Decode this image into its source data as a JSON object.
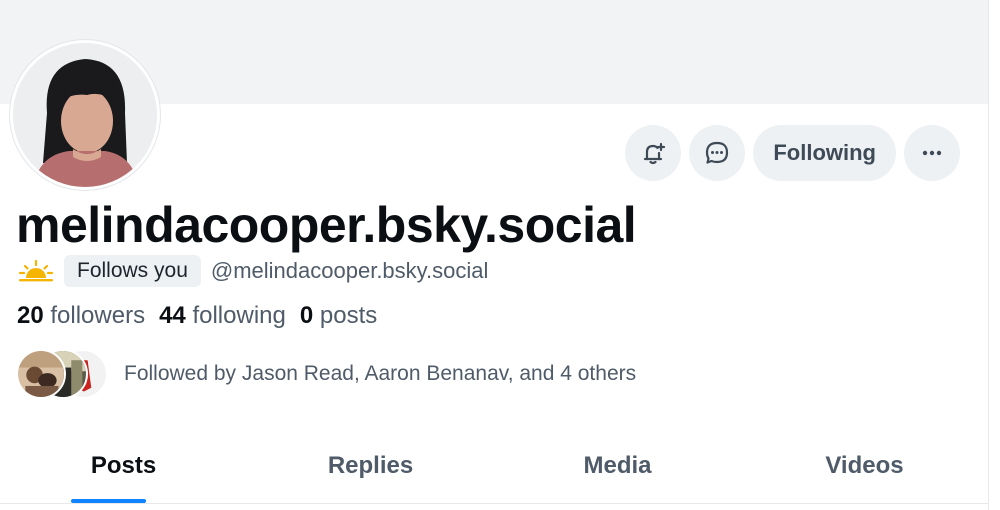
{
  "profile": {
    "display_name": "melindacooper.bsky.social",
    "handle": "@melindacooper.bsky.social",
    "follows_you_label": "Follows you",
    "avatar": "profile-photo",
    "status_icon": "sunrise-emoji"
  },
  "actions": {
    "subscribe_icon": "bell-plus-icon",
    "message_icon": "chat-bubble-icon",
    "following_label": "Following",
    "more_icon": "ellipsis-icon"
  },
  "stats": {
    "followers_count": "20",
    "followers_label": "followers",
    "following_count": "44",
    "following_label": "following",
    "posts_count": "0",
    "posts_label": "posts"
  },
  "followed_by": {
    "text": "Followed by Jason Read, Aaron Benanav, and 4 others"
  },
  "tabs": [
    {
      "label": "Posts",
      "active": true
    },
    {
      "label": "Replies",
      "active": false
    },
    {
      "label": "Media",
      "active": false
    },
    {
      "label": "Videos",
      "active": false
    }
  ],
  "colors": {
    "accent": "#1083fe",
    "banner": "#f1f3f5",
    "button_bg": "#eef1f4",
    "muted_text": "#4f5b68"
  }
}
